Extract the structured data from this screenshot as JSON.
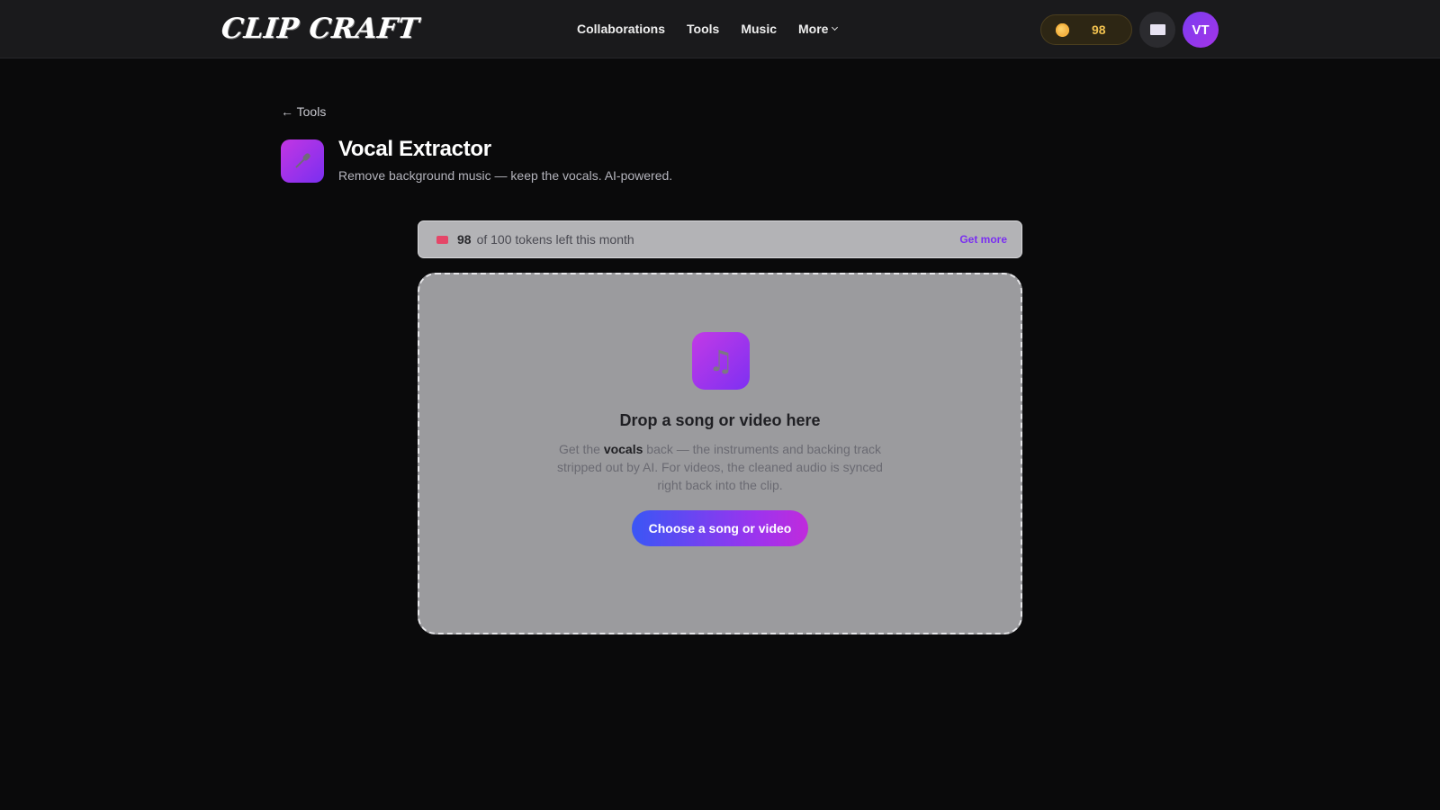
{
  "header": {
    "logo_text": "CLIP CRAFT",
    "nav": [
      {
        "label": "Collaborations"
      },
      {
        "label": "Tools"
      },
      {
        "label": "Music"
      },
      {
        "label": "More"
      }
    ],
    "coins": "98",
    "avatar_initials": "VT"
  },
  "page": {
    "back_label": "← Tools",
    "title": "Vocal Extractor",
    "subtitle": "Remove background music — keep the vocals. AI-powered."
  },
  "tokens": {
    "count": "98",
    "text": "of 100 tokens left this month",
    "get_more": "Get more"
  },
  "dropzone": {
    "icon": "♫",
    "title": "Drop a song or video here",
    "desc_before": "Get the ",
    "desc_bold": "vocals",
    "desc_after": " back — the instruments and backing track stripped out by AI. For videos, the cleaned audio is synced right back into the clip.",
    "button": "Choose a song or video"
  },
  "colors": {
    "accent": "#7a2ff0",
    "coin_text": "#f2c24f",
    "button_start": "#3a56f5",
    "button_end": "#c02bdc"
  }
}
